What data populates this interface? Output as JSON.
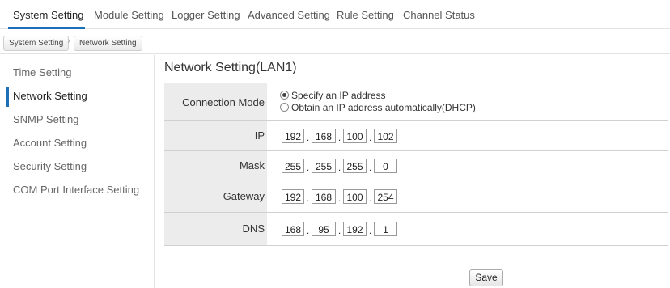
{
  "top_nav": {
    "tabs": [
      {
        "label": "System Setting",
        "active": true
      },
      {
        "label": "Module Setting"
      },
      {
        "label": "Logger Setting"
      },
      {
        "label": "Advanced Setting"
      },
      {
        "label": "Rule Setting"
      },
      {
        "label": "Channel Status"
      }
    ]
  },
  "breadcrumb": [
    "System Setting",
    "Network Setting"
  ],
  "sidebar": {
    "items": [
      {
        "label": "Time Setting"
      },
      {
        "label": "Network Setting",
        "active": true
      },
      {
        "label": "SNMP Setting"
      },
      {
        "label": "Account Setting"
      },
      {
        "label": "Security Setting"
      },
      {
        "label": "COM Port Interface Setting"
      }
    ]
  },
  "page_title": "Network Setting(LAN1)",
  "form": {
    "connection_mode": {
      "label": "Connection Mode",
      "options": [
        "Specify an IP address",
        "Obtain an IP address automatically(DHCP)"
      ],
      "selected_index": 0
    },
    "ip": {
      "label": "IP",
      "octets": [
        "192",
        "168",
        "100",
        "102"
      ]
    },
    "mask": {
      "label": "Mask",
      "octets": [
        "255",
        "255",
        "255",
        "0"
      ]
    },
    "gateway": {
      "label": "Gateway",
      "octets": [
        "192",
        "168",
        "100",
        "254"
      ]
    },
    "dns": {
      "label": "DNS",
      "octets": [
        "168",
        "95",
        "192",
        "1"
      ]
    }
  },
  "save_label": "Save",
  "colors": {
    "accent": "#1d6fb8",
    "label_bg": "#ececec"
  }
}
